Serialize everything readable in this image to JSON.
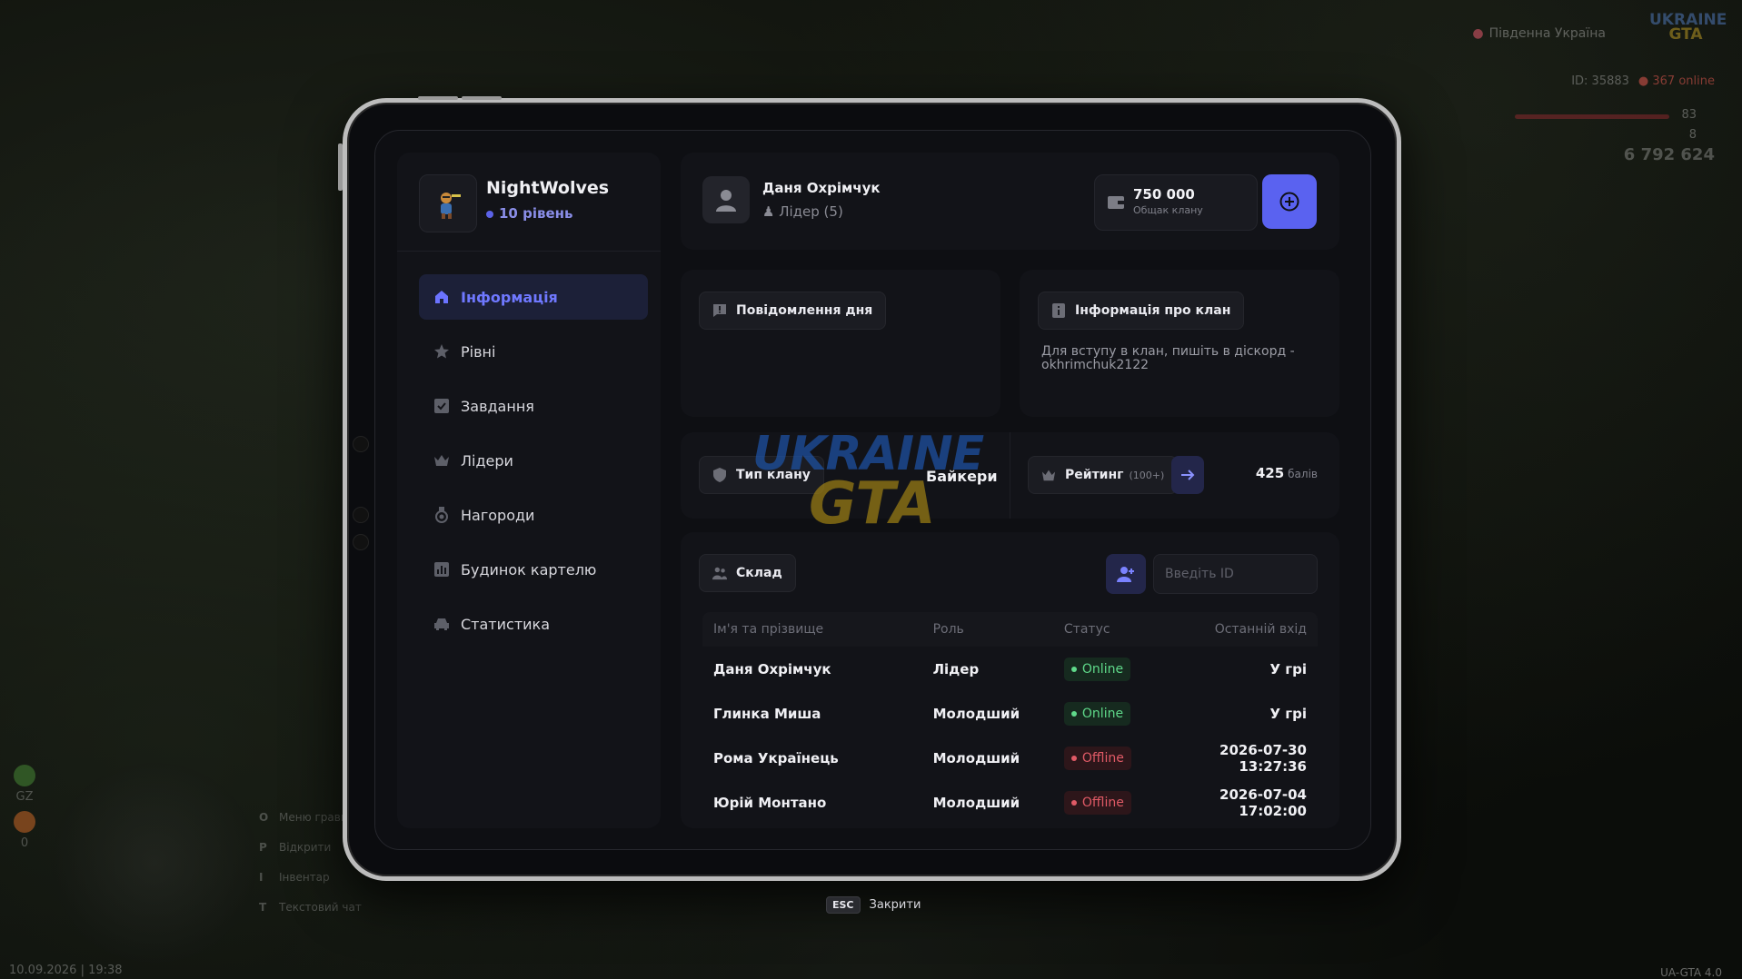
{
  "hud": {
    "region": "Південна Україна",
    "logo_top": "UKRAINE",
    "logo_bottom": "GTA",
    "player_id": "ID: 35883",
    "online": "367 online",
    "health_value": "83",
    "armor_value": "8",
    "money": "6 792 624",
    "left_label_1": "GZ",
    "left_value": "0",
    "menu": [
      {
        "key": "O",
        "label": "Меню гравця"
      },
      {
        "key": "P",
        "label": "Відкрити"
      },
      {
        "key": "I",
        "label": "Інвентар"
      },
      {
        "key": "T",
        "label": "Текстовий чат"
      }
    ],
    "datetime": "10.09.2026 | 19:38",
    "version": "UA-GTA 4.0"
  },
  "clan": {
    "name": "NightWolves",
    "level": "10 рівень",
    "avatar_icon": "clan-emblem"
  },
  "nav": [
    {
      "label": "Інформація",
      "icon": "home-icon",
      "active": true
    },
    {
      "label": "Рівні",
      "icon": "star-icon",
      "active": false
    },
    {
      "label": "Завдання",
      "icon": "checkbox-icon",
      "active": false
    },
    {
      "label": "Лідери",
      "icon": "crown-icon",
      "active": false
    },
    {
      "label": "Нагороди",
      "icon": "medal-icon",
      "active": false
    },
    {
      "label": "Будинок картелю",
      "icon": "chart-icon",
      "active": false
    },
    {
      "label": "Статистика",
      "icon": "car-icon",
      "active": false
    }
  ],
  "user": {
    "name": "Даня Охрімчук",
    "role": "Лідер (5)"
  },
  "wallet": {
    "amount": "750 000",
    "label": "Общак клану"
  },
  "motd": {
    "title": "Повідомлення дня",
    "text": ""
  },
  "clan_info": {
    "title": "Інформація про клан",
    "text": "Для вступу в клан, пишіть в діскорд - okhrimchuk2122"
  },
  "clan_type": {
    "label": "Тип клану",
    "value": "Байкери"
  },
  "rating": {
    "label": "Рейтинг",
    "sub": "(100+)",
    "points": "425",
    "points_unit": "балів"
  },
  "roster": {
    "title": "Склад",
    "input_placeholder": "Введіть ID",
    "columns": [
      "Ім'я та прізвище",
      "Роль",
      "Статус",
      "Останній вхід"
    ],
    "rows": [
      {
        "name": "Даня Охрімчук",
        "role": "Лідер",
        "status": "Online",
        "last": "У грі"
      },
      {
        "name": "Глинка Миша",
        "role": "Молодший",
        "status": "Online",
        "last": "У грі"
      },
      {
        "name": "Рома Українець",
        "role": "Молодший",
        "status": "Offline",
        "last": "2026-07-30 13:27:36"
      },
      {
        "name": "Юрій Монтано",
        "role": "Молодший",
        "status": "Offline",
        "last": "2026-07-04 17:02:00"
      }
    ]
  },
  "watermark": {
    "top": "UKRAINE",
    "bottom": "GTA"
  },
  "footer": {
    "key": "ESC",
    "label": "Закрити"
  },
  "colors": {
    "accent": "#5a62f0",
    "online": "#5fd98a",
    "offline": "#e05a66"
  }
}
